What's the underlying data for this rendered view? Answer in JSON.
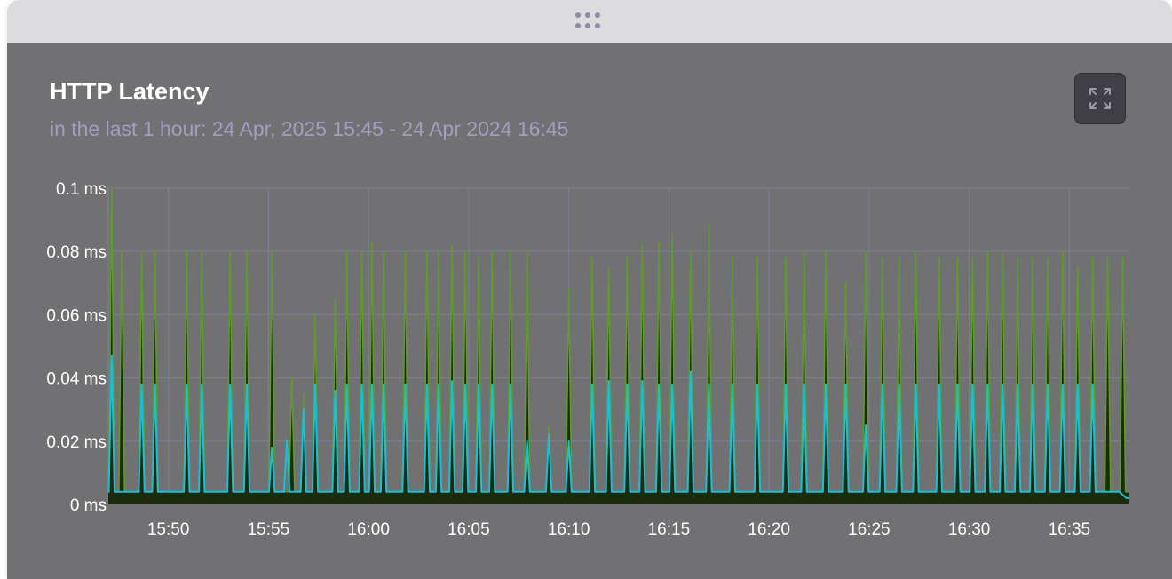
{
  "panel": {
    "title": "HTTP Latency",
    "subtitle": "in the last 1 hour: 24 Apr, 2025 15:45 - 24 Apr 2024 16:45",
    "expand_icon": "expand-arrows-icon",
    "drag_icon": "drag-dots-icon"
  },
  "colors": {
    "background": "#717073",
    "series_green": "#5e9b2b",
    "series_cyan": "#19bfd6",
    "fill": "#1c2a0d",
    "grid": "#7f7e95"
  },
  "chart_data": {
    "type": "line",
    "title": "HTTP Latency",
    "xlabel": "",
    "ylabel": "",
    "y_unit": "ms",
    "ylim": [
      0,
      0.1
    ],
    "y_ticks": [
      "0 ms",
      "0.02 ms",
      "0.04 ms",
      "0.06 ms",
      "0.08 ms",
      "0.1 ms"
    ],
    "x_ticks": [
      "15:50",
      "15:55",
      "16:00",
      "16:05",
      "16:10",
      "16:15",
      "16:20",
      "16:25",
      "16:30",
      "16:35"
    ],
    "x_range": [
      "15:47",
      "16:38"
    ],
    "grid": true,
    "legend": "none",
    "baseline": 0.004,
    "series": [
      {
        "color": "#5e9b2b",
        "filled": true,
        "spike_times": [
          "15:47:10",
          "15:47:40",
          "15:48:40",
          "15:49:20",
          "15:50:55",
          "15:51:40",
          "15:53:05",
          "15:53:55",
          "15:55:10",
          "15:56:10",
          "15:56:45",
          "15:57:20",
          "15:58:20",
          "15:58:55",
          "15:59:40",
          "16:00:10",
          "16:00:45",
          "16:01:50",
          "16:02:55",
          "16:03:30",
          "16:04:10",
          "16:04:50",
          "16:05:30",
          "16:06:10",
          "16:07:05",
          "16:07:55",
          "16:09:00",
          "16:10:00",
          "16:11:10",
          "16:12:00",
          "16:12:55",
          "16:13:40",
          "16:14:30",
          "16:15:10",
          "16:16:05",
          "16:17:00",
          "16:18:10",
          "16:19:25",
          "16:20:50",
          "16:21:45",
          "16:22:50",
          "16:23:50",
          "16:24:50",
          "16:25:40",
          "16:26:30",
          "16:27:20",
          "16:28:30",
          "16:29:25",
          "16:30:10",
          "16:30:55",
          "16:31:40",
          "16:32:25",
          "16:33:10",
          "16:33:55",
          "16:34:40",
          "16:35:25",
          "16:36:10",
          "16:36:55",
          "16:37:40"
        ],
        "spike_values": [
          0.1,
          0.08,
          0.08,
          0.08,
          0.08,
          0.08,
          0.08,
          0.08,
          0.08,
          0.04,
          0.035,
          0.06,
          0.065,
          0.08,
          0.08,
          0.083,
          0.08,
          0.08,
          0.08,
          0.08,
          0.082,
          0.08,
          0.078,
          0.08,
          0.08,
          0.08,
          0.025,
          0.068,
          0.078,
          0.075,
          0.078,
          0.082,
          0.083,
          0.085,
          0.08,
          0.089,
          0.078,
          0.078,
          0.078,
          0.08,
          0.08,
          0.07,
          0.08,
          0.078,
          0.078,
          0.08,
          0.078,
          0.078,
          0.078,
          0.08,
          0.08,
          0.078,
          0.078,
          0.078,
          0.08,
          0.075,
          0.078,
          0.078,
          0.078
        ]
      },
      {
        "color": "#19bfd6",
        "filled": false,
        "spike_times": [
          "15:47:10",
          "15:48:40",
          "15:49:20",
          "15:50:55",
          "15:51:40",
          "15:53:05",
          "15:53:55",
          "15:55:10",
          "15:55:55",
          "15:56:45",
          "15:57:20",
          "15:58:20",
          "15:58:55",
          "15:59:40",
          "16:00:10",
          "16:00:45",
          "16:01:50",
          "16:02:55",
          "16:03:30",
          "16:04:10",
          "16:04:50",
          "16:05:30",
          "16:06:10",
          "16:07:05",
          "16:07:55",
          "16:09:00",
          "16:10:00",
          "16:11:10",
          "16:12:00",
          "16:12:55",
          "16:13:40",
          "16:14:30",
          "16:15:10",
          "16:16:05",
          "16:17:00",
          "16:18:10",
          "16:19:25",
          "16:20:50",
          "16:21:45",
          "16:22:50",
          "16:23:50",
          "16:24:50",
          "16:25:40",
          "16:26:30",
          "16:27:20",
          "16:28:30",
          "16:29:25",
          "16:30:10",
          "16:30:55",
          "16:31:40",
          "16:32:25",
          "16:33:10",
          "16:33:55",
          "16:34:40",
          "16:35:25",
          "16:36:10"
        ],
        "spike_values": [
          0.047,
          0.038,
          0.038,
          0.038,
          0.038,
          0.038,
          0.038,
          0.018,
          0.02,
          0.03,
          0.038,
          0.036,
          0.038,
          0.038,
          0.038,
          0.038,
          0.038,
          0.038,
          0.038,
          0.039,
          0.038,
          0.038,
          0.038,
          0.038,
          0.02,
          0.022,
          0.02,
          0.038,
          0.039,
          0.038,
          0.039,
          0.038,
          0.038,
          0.042,
          0.038,
          0.038,
          0.038,
          0.038,
          0.038,
          0.038,
          0.038,
          0.025,
          0.038,
          0.038,
          0.038,
          0.038,
          0.038,
          0.038,
          0.038,
          0.038,
          0.038,
          0.038,
          0.038,
          0.038,
          0.038,
          0.038
        ],
        "tail_value": 0.002
      }
    ]
  }
}
